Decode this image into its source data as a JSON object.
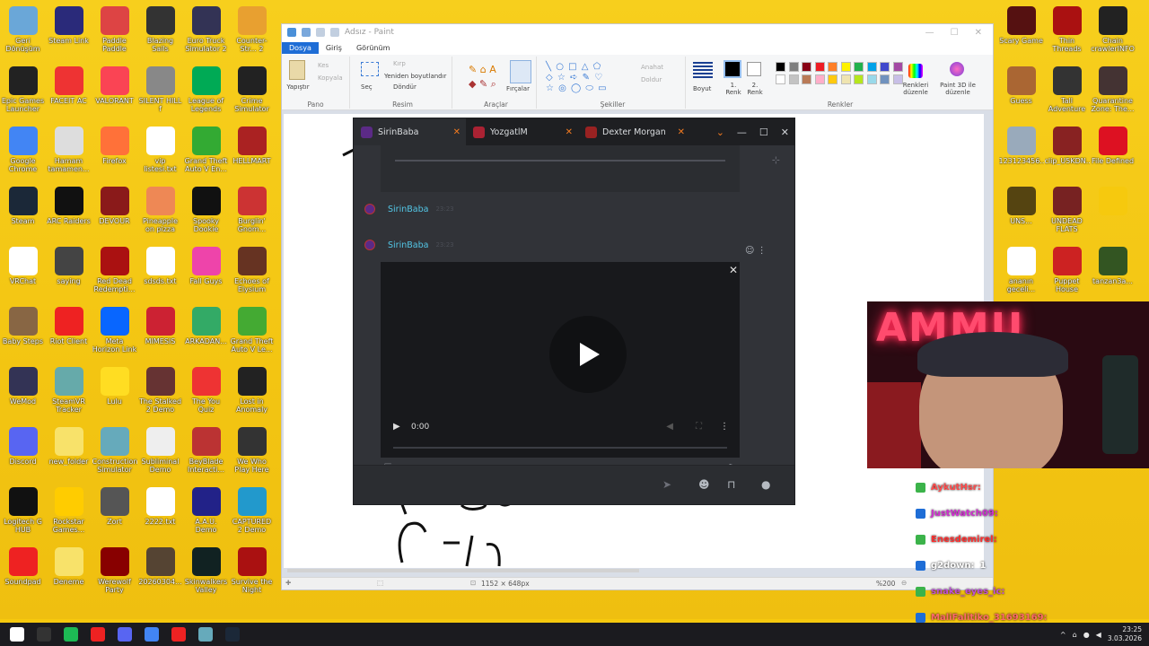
{
  "desktop": {
    "left_icons": [
      {
        "label": "Geri Dönüşüm",
        "color": "#6aa7d8"
      },
      {
        "label": "Steam Link",
        "color": "#2a2a7a"
      },
      {
        "label": "Paddle Paddle",
        "color": "#d44"
      },
      {
        "label": "Blazing Sails",
        "color": "#333"
      },
      {
        "label": "Euro Truck Simulator 2",
        "color": "#335"
      },
      {
        "label": "Counter-Str... 2",
        "color": "#e8a030"
      },
      {
        "label": "Epic Games Launcher",
        "color": "#222"
      },
      {
        "label": "FACEIT AC",
        "color": "#e33"
      },
      {
        "label": "VALORANT",
        "color": "#fa4454"
      },
      {
        "label": "SILENT HILL f",
        "color": "#888"
      },
      {
        "label": "League of Legends",
        "color": "#0a5"
      },
      {
        "label": "Crime Simulator",
        "color": "#222"
      },
      {
        "label": "Google Chrome",
        "color": "#4285f4"
      },
      {
        "label": "Hamam tamamen...",
        "color": "#ddd"
      },
      {
        "label": "Firefox",
        "color": "#ff7139"
      },
      {
        "label": "vip listesi.txt",
        "color": "#fff"
      },
      {
        "label": "Grand Theft Auto V En...",
        "color": "#3a3"
      },
      {
        "label": "HELLMART",
        "color": "#a22"
      },
      {
        "label": "Steam",
        "color": "#1b2838"
      },
      {
        "label": "ARC Raiders",
        "color": "#111"
      },
      {
        "label": "DEVOUR",
        "color": "#8a1a1a"
      },
      {
        "label": "Pineapple on pizza",
        "color": "#e85"
      },
      {
        "label": "Spooky Dookie",
        "color": "#111"
      },
      {
        "label": "Burglin' Gnom...",
        "color": "#c33"
      },
      {
        "label": "VRChat",
        "color": "#fff"
      },
      {
        "label": "saying",
        "color": "#444"
      },
      {
        "label": "Red Dead Redempti...",
        "color": "#a11"
      },
      {
        "label": "sdsds.txt",
        "color": "#fff"
      },
      {
        "label": "Fall Guys",
        "color": "#e4a"
      },
      {
        "label": "Echoes of Elysium",
        "color": "#632"
      },
      {
        "label": "Baby Steps",
        "color": "#864"
      },
      {
        "label": "Riot Client",
        "color": "#e22"
      },
      {
        "label": "Meta Horizon Link",
        "color": "#0866ff"
      },
      {
        "label": "MIMESIS",
        "color": "#c23"
      },
      {
        "label": "ARKADAN...",
        "color": "#3a6"
      },
      {
        "label": "Grand Theft Auto V Le...",
        "color": "#4a3"
      },
      {
        "label": "WeMod",
        "color": "#335"
      },
      {
        "label": "SteamVR Tracker",
        "color": "#6aa"
      },
      {
        "label": "Lulu",
        "color": "#fd2"
      },
      {
        "label": "The Stalked 2 Demo",
        "color": "#633"
      },
      {
        "label": "The You Quiz",
        "color": "#e33"
      },
      {
        "label": "Lost in Anomaly",
        "color": "#222"
      },
      {
        "label": "Discord",
        "color": "#5865f2"
      },
      {
        "label": "new_folder",
        "color": "#f8e26a"
      },
      {
        "label": "Construction Simulator",
        "color": "#6ab"
      },
      {
        "label": "Subliminal Demo",
        "color": "#eee"
      },
      {
        "label": "BeyBlade Interacti...",
        "color": "#b33"
      },
      {
        "label": "We Who Play Here",
        "color": "#333"
      },
      {
        "label": "Logitech G HUB",
        "color": "#111"
      },
      {
        "label": "Rockstar Games...",
        "color": "#fc0"
      },
      {
        "label": "Zort",
        "color": "#555"
      },
      {
        "label": "2222.txt",
        "color": "#fff"
      },
      {
        "label": "A.A.U. Demo",
        "color": "#228"
      },
      {
        "label": "CAPTURED 2 Demo",
        "color": "#29c"
      },
      {
        "label": "Soundpad",
        "color": "#e22"
      },
      {
        "label": "Deneme",
        "color": "#f8e26a"
      },
      {
        "label": "Werewolf Party",
        "color": "#800"
      },
      {
        "label": "20260304...",
        "color": "#543"
      },
      {
        "label": "Skinwalkers Valley",
        "color": "#122"
      },
      {
        "label": "Survive the Night",
        "color": "#a11"
      }
    ],
    "right_icons": [
      {
        "label": "Scary Game",
        "color": "#511"
      },
      {
        "label": "Thin Threads",
        "color": "#a11"
      },
      {
        "label": "Chain crawlerINFO",
        "color": "#222"
      },
      {
        "label": "Guess",
        "color": "#a63"
      },
      {
        "label": "Tall Adventure",
        "color": "#333"
      },
      {
        "label": "Quarantine Zone: The...",
        "color": "#433"
      },
      {
        "label": "123123456...",
        "color": "#9ab"
      },
      {
        "label": "clip_U5KDN...",
        "color": "#822"
      },
      {
        "label": "File Defined",
        "color": "#d12"
      },
      {
        "label": "UNS...",
        "color": "#541"
      },
      {
        "label": "UNDEAD FLATS",
        "color": "#722"
      },
      {
        "label": "",
        "color": "#f6c90e"
      },
      {
        "label": "ananın geceli...",
        "color": "#fff"
      },
      {
        "label": "Puppet House",
        "color": "#c22"
      },
      {
        "label": "tanzan3a...",
        "color": "#352"
      }
    ]
  },
  "paint": {
    "title": "Adsız - Paint",
    "window_controls": [
      "—",
      "☐",
      "✕"
    ],
    "tabs": [
      "Dosya",
      "Giriş",
      "Görünüm"
    ],
    "ribbon": {
      "paste": "Yapıştır",
      "cut": "Kes",
      "copy": "Kopyala",
      "select": "Seç",
      "crop": "Kırp",
      "resize": "Yeniden boyutlandır",
      "rotate": "Döndür",
      "brushes": "Fırçalar",
      "fill": "Anahat",
      "fill2": "Doldur",
      "size": "Boyut",
      "color1": "1. Renk",
      "color2": "2. Renk",
      "edit_colors": "Renkleri düzenle",
      "paint3d": "Paint 3D ile düzenle",
      "groups": [
        "Pano",
        "Resim",
        "Araçlar",
        "Şekiller",
        "Renkler"
      ]
    },
    "palette": [
      "#000000",
      "#7f7f7f",
      "#880015",
      "#ed1c24",
      "#ff7f27",
      "#fff200",
      "#22b14c",
      "#00a2e8",
      "#3f48cc",
      "#a349a4",
      "#ffffff",
      "#c3c3c3",
      "#b97a57",
      "#ffaec9",
      "#ffc90e",
      "#efe4b0",
      "#b5e61d",
      "#99d9ea",
      "#7092be",
      "#c8bfe7"
    ],
    "status": {
      "size": "1152 × 648px",
      "zoom": "%200"
    }
  },
  "discord": {
    "tabs": [
      {
        "label": "SirinBaba",
        "color": "#5b2a86"
      },
      {
        "label": "YozgatlM",
        "color": "#a23"
      },
      {
        "label": "Dexter Morgan",
        "color": "#922"
      }
    ],
    "messages": [
      {
        "author": "SirinBaba",
        "time": "23:23"
      },
      {
        "author": "SirinBaba",
        "time": "23:23"
      }
    ],
    "video": {
      "time": "0:00"
    }
  },
  "webcam": {
    "neon_text": "AMMU"
  },
  "chat": {
    "lines": [
      {
        "name": "AykutHsr:",
        "color": "#ff4d4d"
      },
      {
        "name": "JustWatch09:",
        "color": "#d12fd1"
      },
      {
        "name": "Enesdemirel:",
        "color": "#ff3030"
      },
      {
        "name": "g2down:",
        "color": "#ffffff",
        "msg": "1"
      },
      {
        "name": "snake_eyes_ic:",
        "color": "#c04fd8"
      },
      {
        "name": "MaliFalitiko_31693169:",
        "color": "#ff6a6a"
      }
    ]
  },
  "taskbar": {
    "apps": [
      {
        "name": "windows-start",
        "color": "#ffffff"
      },
      {
        "name": "obs",
        "color": "#333333"
      },
      {
        "name": "spotify",
        "color": "#1db954"
      },
      {
        "name": "record",
        "color": "#e22"
      },
      {
        "name": "discord",
        "color": "#5865f2"
      },
      {
        "name": "chrome",
        "color": "#4285f4"
      },
      {
        "name": "youtube",
        "color": "#e22"
      },
      {
        "name": "gallery",
        "color": "#6ab"
      },
      {
        "name": "steam",
        "color": "#1b2838"
      }
    ],
    "time": "23:25",
    "date": "3.03.2026"
  }
}
